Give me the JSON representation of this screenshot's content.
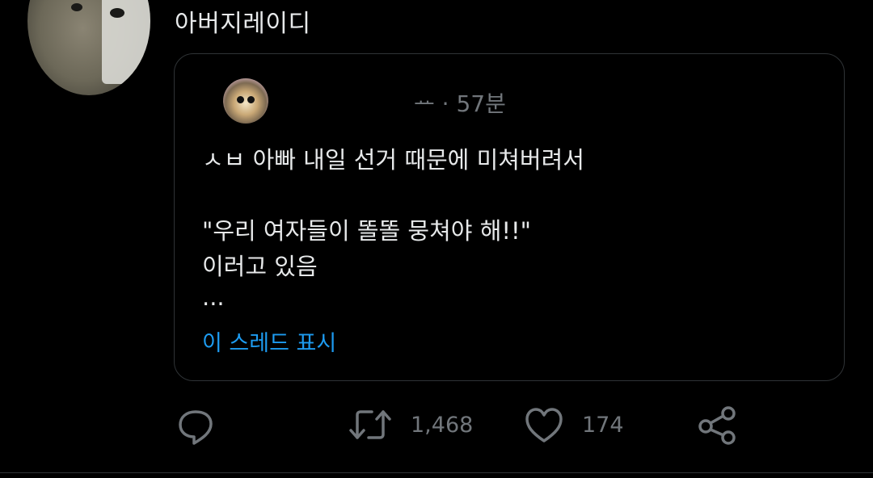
{
  "tweet": {
    "author_name": "아버지레이디"
  },
  "quoted_tweet": {
    "handle_fragment": "ᅭ",
    "separator": "·",
    "time": "57분",
    "lines": [
      "ㅅㅂ 아빠 내일 선거 때문에 미쳐버려서",
      "\"우리 여자들이 똘똘 뭉쳐야 해!!\"",
      "이러고 있음",
      "..."
    ],
    "show_thread": "이 스레드 표시"
  },
  "actions": {
    "reply_icon": "reply-icon",
    "retweet_icon": "retweet-icon",
    "retweet_count": "1,468",
    "like_icon": "heart-icon",
    "like_count": "174",
    "share_icon": "share-icon"
  },
  "colors": {
    "background": "#000000",
    "text": "#e7e9ea",
    "muted": "#71767b",
    "link": "#1d9bf0",
    "border": "#2f3336"
  }
}
